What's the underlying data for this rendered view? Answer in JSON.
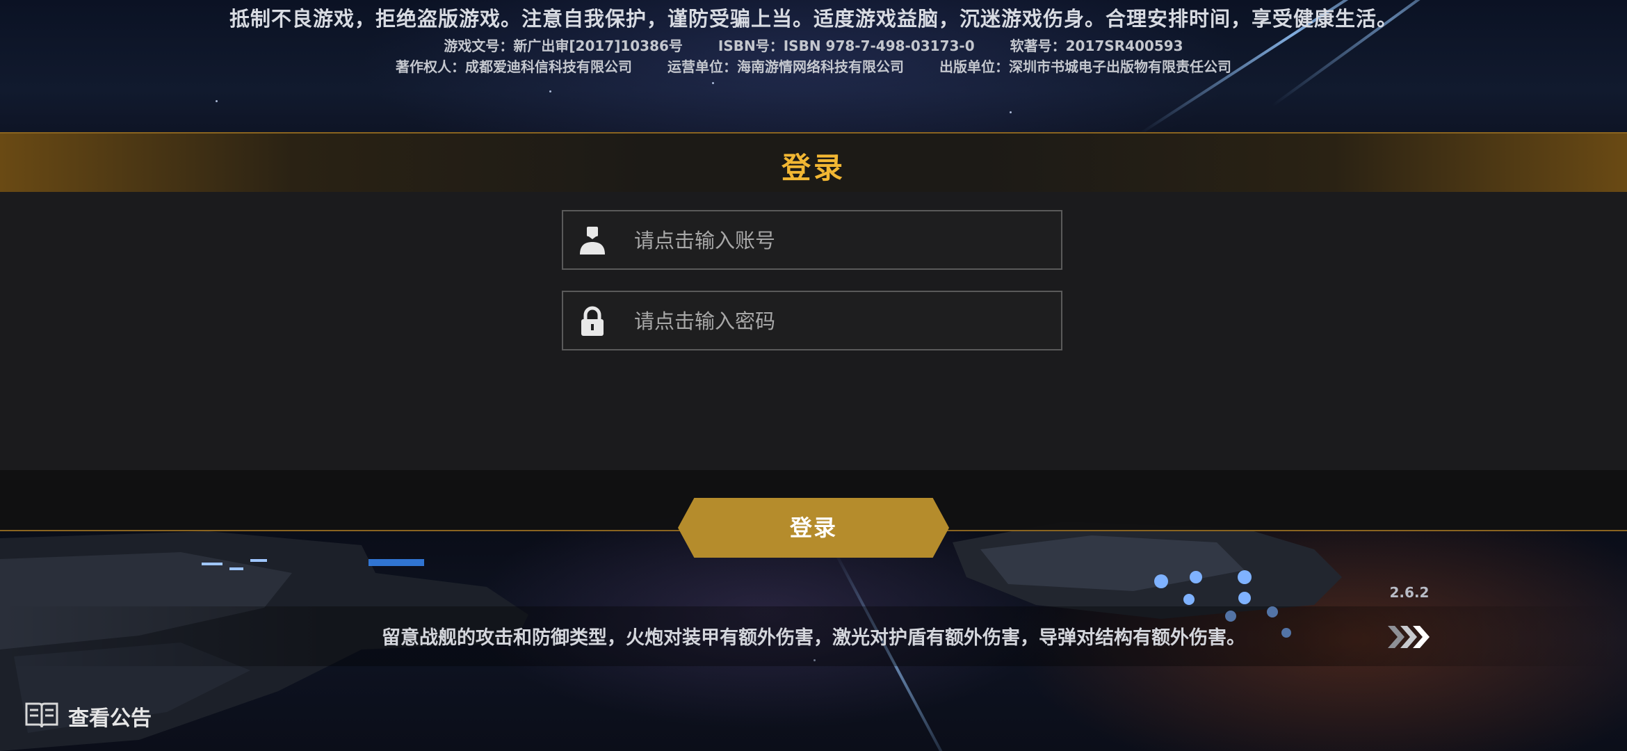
{
  "notice": {
    "main": "抵制不良游戏，拒绝盗版游戏。注意自我保护，谨防受骗上当。适度游戏益脑，沉迷游戏伤身。合理安排时间，享受健康生活。",
    "line1": [
      "游戏文号：新广出审[2017]10386号",
      "ISBN号：ISBN 978-7-498-03173-0",
      "软著号：2017SR400593"
    ],
    "line2": [
      "著作权人：成都爱迪科信科技有限公司",
      "运营单位：海南游情网络科技有限公司",
      "出版单位：深圳市书城电子出版物有限责任公司"
    ]
  },
  "login_panel": {
    "title": "登录",
    "account_field": {
      "placeholder": "请点击输入账号",
      "value": "",
      "icon": "user-icon"
    },
    "password_field": {
      "placeholder": "请点击输入密码",
      "value": "",
      "icon": "lock-icon"
    },
    "submit_label": "登录"
  },
  "bottom": {
    "version": "2.6.2",
    "tip": "留意战舰的攻击和防御类型，火炮对装甲有额外伤害，激光对护盾有额外伤害，导弹对结构有额外伤害。",
    "next_icon": "triple-chevron-right-icon",
    "announcement_label": "查看公告",
    "announcement_icon": "book-icon"
  },
  "colors": {
    "accent_gold": "#f2b733",
    "button_gold": "#b58c2c",
    "panel_border": "#8a6420"
  }
}
